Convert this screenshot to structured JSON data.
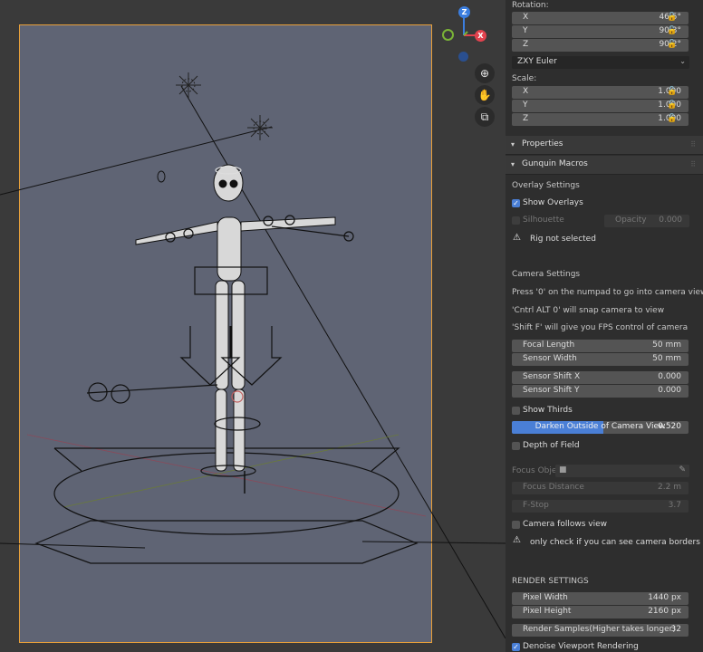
{
  "transform": {
    "rotation_label": "Rotation:",
    "rotation": [
      {
        "axis": "X",
        "value": "46.5°"
      },
      {
        "axis": "Y",
        "value": "90.3°"
      },
      {
        "axis": "Z",
        "value": "90.2°"
      }
    ],
    "rotation_mode": "ZXY Euler",
    "scale_label": "Scale:",
    "scale": [
      {
        "axis": "X",
        "value": "1.000"
      },
      {
        "axis": "Y",
        "value": "1.000"
      },
      {
        "axis": "Z",
        "value": "1.000"
      }
    ]
  },
  "panels": {
    "properties": "Properties",
    "gunquin": "Gunquin Macros"
  },
  "overlay": {
    "section": "Overlay Settings",
    "show_overlays": "Show Overlays",
    "silhouette": "Silhouette",
    "opacity_label": "Opacity",
    "opacity_value": "0.000",
    "rig_warning": "Rig not selected"
  },
  "camera": {
    "section": "Camera Settings",
    "tip1": "Press '0' on the numpad to go into camera view",
    "tip2": "'Cntrl ALT 0' will snap camera to view",
    "tip3": "'Shift F' will give you FPS control of camera",
    "focal_length_label": "Focal Length",
    "focal_length": "50 mm",
    "sensor_width_label": "Sensor Width",
    "sensor_width": "50 mm",
    "shift_x_label": "Sensor Shift X",
    "shift_x": "0.000",
    "shift_y_label": "Sensor Shift Y",
    "shift_y": "0.000",
    "show_thirds": "Show Thirds",
    "darken_label": "Darken Outside of Camera View",
    "darken_value": "0.520",
    "darken_fraction": 0.52,
    "dof": "Depth of Field",
    "focus_obj": "Focus Obje",
    "focus_distance_label": "Focus Distance",
    "focus_distance": "2.2 m",
    "fstop_label": "F-Stop",
    "fstop": "3.7",
    "follows": "Camera follows view",
    "border_warning": "only check if you can see camera borders"
  },
  "render": {
    "section": "RENDER SETTINGS",
    "pixel_width_label": "Pixel Width",
    "pixel_width": "1440 px",
    "pixel_height_label": "Pixel Height",
    "pixel_height": "2160 px",
    "samples_label": "Render Samples(Higher takes longer)",
    "samples": "32",
    "denoise": "Denoise Viewport Rendering"
  },
  "gizmo": {
    "x": "X",
    "y": "Y",
    "z": "Z",
    "colors": {
      "x": "#e2424e",
      "y": "#7ab337",
      "z": "#3b7ee0"
    }
  },
  "colors": {
    "accent": "#4a7fd6",
    "camera_border": "#e8a03a",
    "viewport_bg": "#5f6474"
  }
}
